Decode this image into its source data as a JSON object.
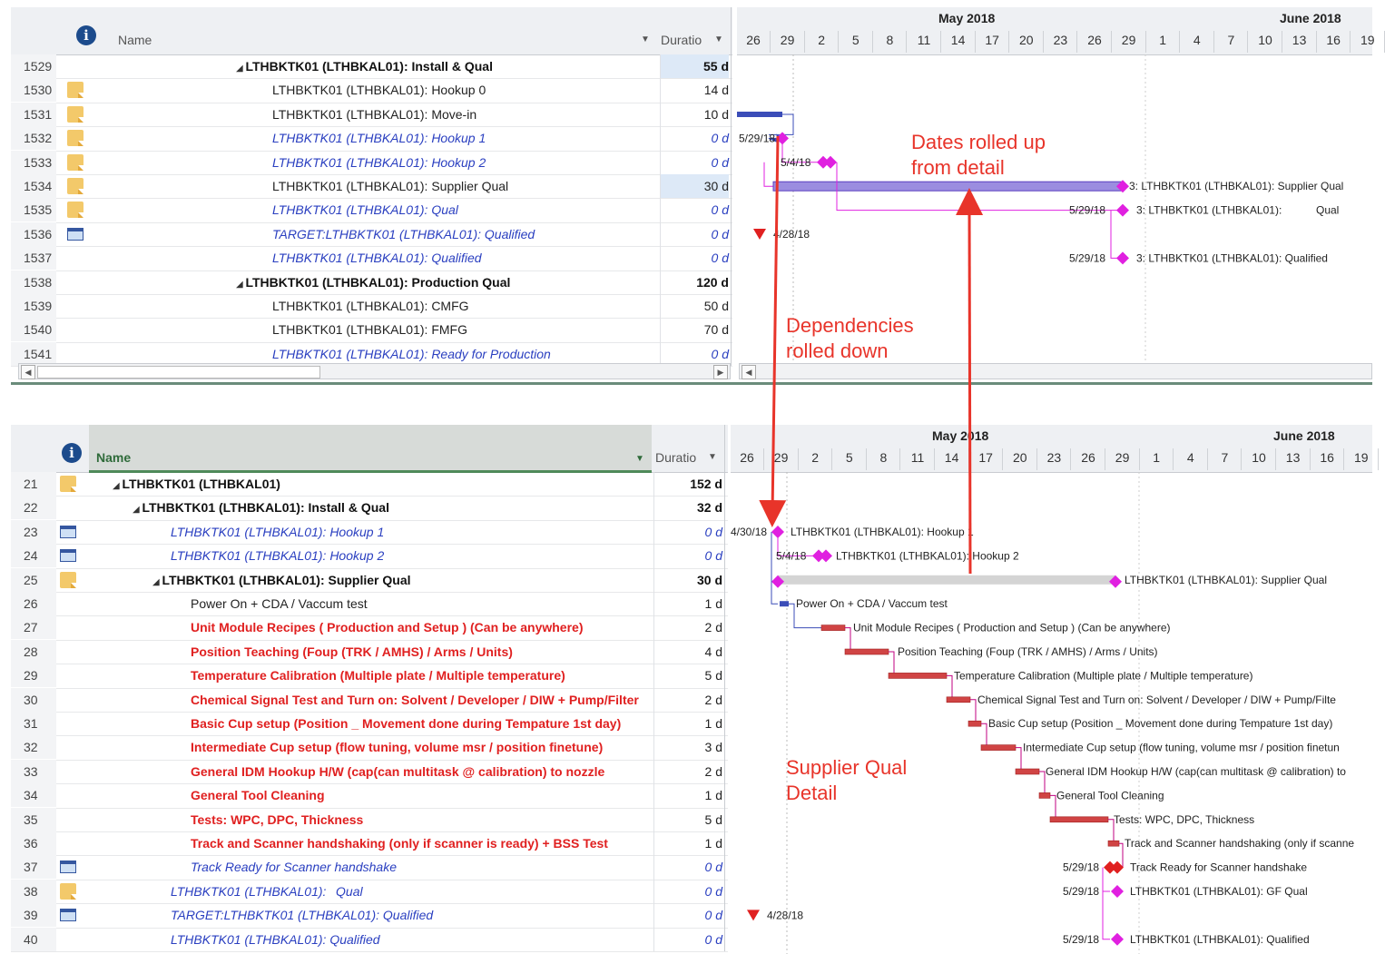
{
  "top": {
    "header": {
      "name": "Name",
      "duration": "Duratio",
      "info": "i"
    },
    "rows": [
      {
        "id": "1529",
        "name": "LTHBKTK01 (LTHBKAL01): Install & Qual",
        "dur": "55 d",
        "style": "sum",
        "icon": ""
      },
      {
        "id": "1530",
        "name": "LTHBKTK01 (LTHBKAL01): Hookup 0",
        "dur": "14 d",
        "style": "",
        "icon": "note"
      },
      {
        "id": "1531",
        "name": "LTHBKTK01 (LTHBKAL01): Move-in",
        "dur": "10 d",
        "style": "",
        "icon": "note"
      },
      {
        "id": "1532",
        "name": "LTHBKTK01 (LTHBKAL01): Hookup 1",
        "dur": "0 d",
        "style": "ms",
        "icon": "note"
      },
      {
        "id": "1533",
        "name": "LTHBKTK01 (LTHBKAL01): Hookup 2",
        "dur": "0 d",
        "style": "ms",
        "icon": "note"
      },
      {
        "id": "1534",
        "name": "LTHBKTK01 (LTHBKAL01): Supplier Qual",
        "dur": "30 d",
        "style": "",
        "icon": "note"
      },
      {
        "id": "1535",
        "name": "LTHBKTK01 (LTHBKAL01):        Qual",
        "dur": "0 d",
        "style": "ms",
        "icon": "note"
      },
      {
        "id": "1536",
        "name": "TARGET:LTHBKTK01 (LTHBKAL01): Qualified",
        "dur": "0 d",
        "style": "ms",
        "icon": "cal"
      },
      {
        "id": "1537",
        "name": "LTHBKTK01 (LTHBKAL01): Qualified",
        "dur": "0 d",
        "style": "ms",
        "icon": ""
      },
      {
        "id": "1538",
        "name": "LTHBKTK01 (LTHBKAL01): Production Qual",
        "dur": "120 d",
        "style": "sum",
        "icon": ""
      },
      {
        "id": "1539",
        "name": "LTHBKTK01 (LTHBKAL01): CMFG",
        "dur": "50 d",
        "style": "",
        "icon": ""
      },
      {
        "id": "1540",
        "name": "LTHBKTK01 (LTHBKAL01): FMFG",
        "dur": "70 d",
        "style": "",
        "icon": ""
      },
      {
        "id": "1541",
        "name": "LTHBKTK01 (LTHBKAL01): Ready for Production",
        "dur": "0 d",
        "style": "ms",
        "icon": ""
      }
    ],
    "timescale": {
      "months": [
        "May 2018",
        "June 2018"
      ],
      "days": [
        "26",
        "29",
        "2",
        "5",
        "8",
        "11",
        "14",
        "17",
        "20",
        "23",
        "26",
        "29",
        "1",
        "4",
        "7",
        "10",
        "13",
        "16",
        "19"
      ]
    },
    "gantt_labels": [
      "5/29/18",
      "5/4/18",
      "3: LTHBKTK01 (LTHBKAL01): Supplier Qual",
      "5/29/18",
      "3: LTHBKTK01 (LTHBKAL01):",
      "Qual",
      "4/28/18",
      "5/29/18",
      "3: LTHBKTK01 (LTHBKAL01): Qualified"
    ]
  },
  "bottom": {
    "header": {
      "name": "Name",
      "duration": "Duratio",
      "info": "i"
    },
    "rows": [
      {
        "id": "21",
        "name": "LTHBKTK01 (LTHBKAL01)",
        "dur": "152 d",
        "style": "sum",
        "icon": "note"
      },
      {
        "id": "22",
        "name": "LTHBKTK01 (LTHBKAL01): Install & Qual",
        "dur": "32 d",
        "style": "sum",
        "icon": ""
      },
      {
        "id": "23",
        "name": "LTHBKTK01 (LTHBKAL01): Hookup 1",
        "dur": "0 d",
        "style": "ms",
        "icon": "cal"
      },
      {
        "id": "24",
        "name": "LTHBKTK01 (LTHBKAL01): Hookup 2",
        "dur": "0 d",
        "style": "ms",
        "icon": "cal"
      },
      {
        "id": "25",
        "name": "LTHBKTK01 (LTHBKAL01): Supplier Qual",
        "dur": "30 d",
        "style": "sum",
        "icon": "note"
      },
      {
        "id": "26",
        "name": "Power On + CDA / Vaccum test",
        "dur": "1 d",
        "style": "",
        "icon": ""
      },
      {
        "id": "27",
        "name": "Unit Module Recipes ( Production and Setup ) (Can be anywhere)",
        "dur": "2 d",
        "style": "red",
        "icon": ""
      },
      {
        "id": "28",
        "name": "Position Teaching (Foup (TRK / AMHS) / Arms / Units)",
        "dur": "4 d",
        "style": "red",
        "icon": ""
      },
      {
        "id": "29",
        "name": "Temperature Calibration (Multiple plate / Multiple temperature)",
        "dur": "5 d",
        "style": "red",
        "icon": ""
      },
      {
        "id": "30",
        "name": "Chemical Signal Test and Turn on: Solvent / Developer / DIW + Pump/Filter",
        "dur": "2 d",
        "style": "red",
        "icon": ""
      },
      {
        "id": "31",
        "name": "Basic Cup setup (Position _ Movement done during Tempature 1st day)",
        "dur": "1 d",
        "style": "red",
        "icon": ""
      },
      {
        "id": "32",
        "name": "Intermediate Cup setup (flow tuning, volume msr / position finetune)",
        "dur": "3 d",
        "style": "red",
        "icon": ""
      },
      {
        "id": "33",
        "name": "General IDM Hookup H/W (cap(can multitask @ calibration) to nozzle",
        "dur": "2 d",
        "style": "red",
        "icon": ""
      },
      {
        "id": "34",
        "name": "General Tool Cleaning",
        "dur": "1 d",
        "style": "red",
        "icon": ""
      },
      {
        "id": "35",
        "name": "Tests: WPC, DPC, Thickness",
        "dur": "5 d",
        "style": "red",
        "icon": ""
      },
      {
        "id": "36",
        "name": "Track and Scanner handshaking (only if scanner is ready) + BSS Test",
        "dur": "1 d",
        "style": "red",
        "icon": ""
      },
      {
        "id": "37",
        "name": "Track Ready for Scanner handshake",
        "dur": "0 d",
        "style": "ms",
        "icon": "cal"
      },
      {
        "id": "38",
        "name": "LTHBKTK01 (LTHBKAL01):       Qual",
        "dur": "0 d",
        "style": "ms",
        "icon": "note"
      },
      {
        "id": "39",
        "name": "TARGET:LTHBKTK01 (LTHBKAL01): Qualified",
        "dur": "0 d",
        "style": "ms",
        "icon": "cal"
      },
      {
        "id": "40",
        "name": "LTHBKTK01 (LTHBKAL01): Qualified",
        "dur": "0 d",
        "style": "ms",
        "icon": ""
      }
    ],
    "timescale": {
      "months": [
        "May 2018",
        "June 2018"
      ],
      "days": [
        "26",
        "29",
        "2",
        "5",
        "8",
        "11",
        "14",
        "17",
        "20",
        "23",
        "26",
        "29",
        "1",
        "4",
        "7",
        "10",
        "13",
        "16",
        "19"
      ]
    },
    "gantt_labels": [
      "4/30/18",
      "LTHBKTK01 (LTHBKAL01): Hookup 1",
      "5/4/18",
      "LTHBKTK01 (LTHBKAL01): Hookup 2",
      "LTHBKTK01 (LTHBKAL01): Supplier Qual",
      "Power On + CDA / Vaccum test",
      "Unit Module Recipes ( Production and Setup ) (Can be anywhere)",
      "Position Teaching (Foup (TRK / AMHS) / Arms / Units)",
      "Temperature Calibration (Multiple plate / Multiple temperature)",
      "Chemical Signal Test and Turn on: Solvent / Developer / DIW + Pump/Filte",
      "Basic Cup setup (Position _ Movement done during Tempature 1st day)",
      "Intermediate Cup setup (flow tuning, volume msr / position finetun",
      "General IDM Hookup H/W (cap(can multitask @ calibration) to",
      "General Tool Cleaning",
      "Tests: WPC, DPC, Thickness",
      "Track and Scanner handshaking (only if scanne",
      "5/29/18",
      "Track Ready for Scanner handshake",
      "5/29/18",
      "LTHBKTK01 (LTHBKAL01): GF Qual",
      "4/28/18",
      "5/29/18",
      "LTHBKTK01 (LTHBKAL01): Qualified"
    ]
  },
  "annotations": {
    "dates_rolled_up": "Dates rolled up\nfrom detail",
    "dependencies_rolled_down": "Dependencies\nrolled down",
    "supplier_qual_detail": "Supplier Qual\nDetail"
  },
  "colors": {
    "accent_red": "#e8342a",
    "milestone": "#e020e0",
    "bar_red": "#c83030",
    "link": "#2a3fc0"
  }
}
